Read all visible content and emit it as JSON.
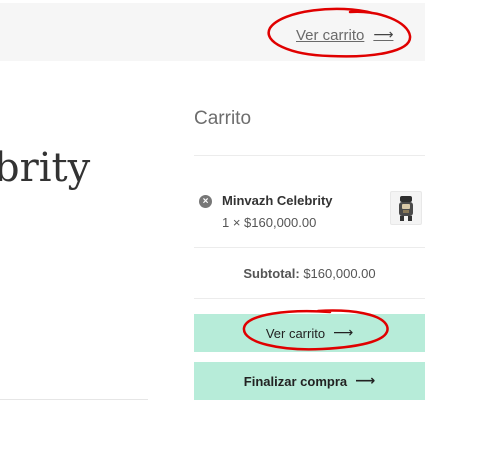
{
  "notice_bar": {
    "view_cart_link": "Ver carrito",
    "arrow_icon": "arrow-right-icon"
  },
  "product": {
    "title_fragment": "brity"
  },
  "cart_widget": {
    "heading": "Carrito",
    "items": [
      {
        "name": "Minvazh Celebrity",
        "quantity_price": "1 × $160,000.00",
        "remove_icon": "remove-x-icon"
      }
    ],
    "subtotal_label": "Subtotal:",
    "subtotal_value": "$160,000.00",
    "view_cart_button": "Ver carrito",
    "checkout_button": "Finalizar compra"
  },
  "colors": {
    "button_bg": "#b7ecd9",
    "annotation_red": "#e00000",
    "notice_bg": "#f6f6f6"
  }
}
